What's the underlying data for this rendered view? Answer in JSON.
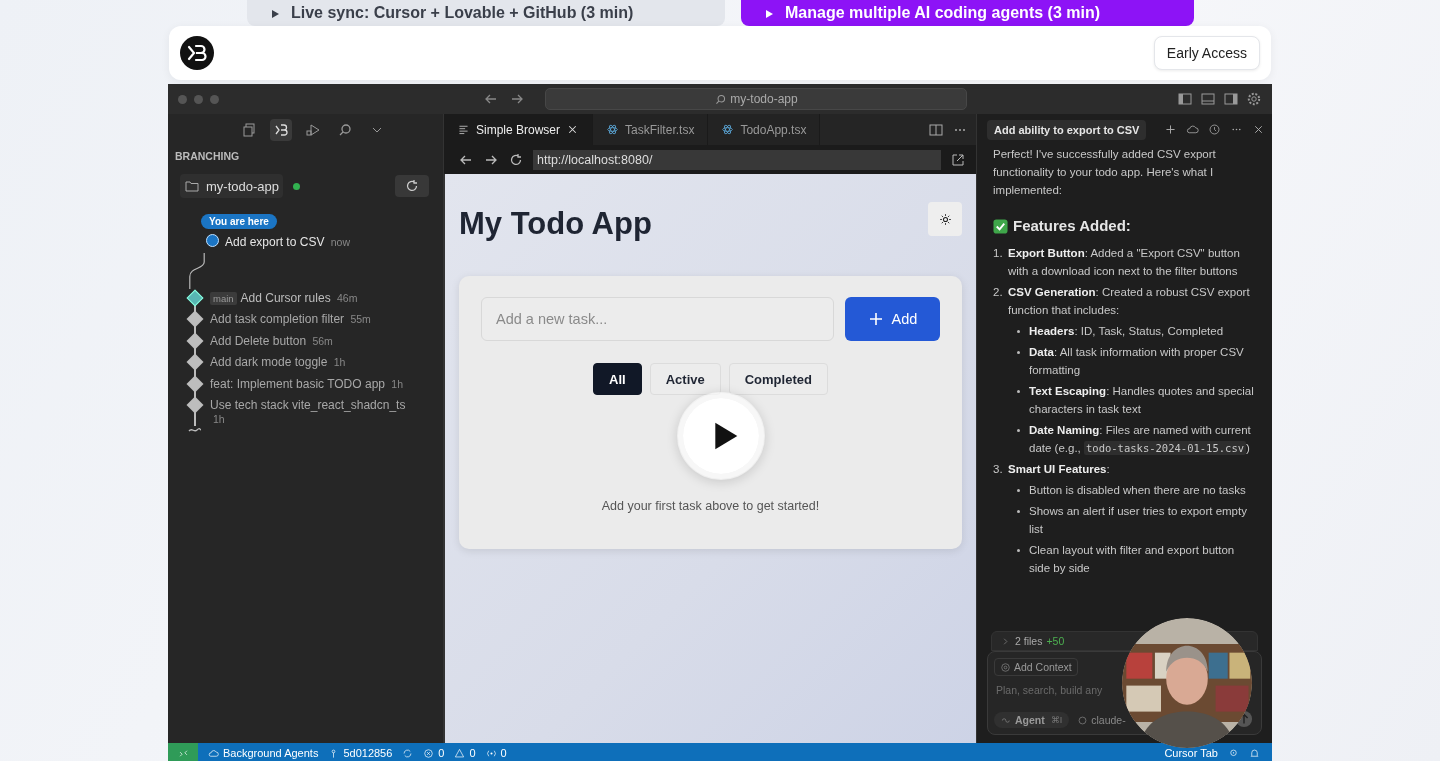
{
  "promo_buttons": [
    {
      "label": "Live sync: Cursor + Lovable + GitHub (3 min)",
      "kind": "secondary"
    },
    {
      "label": "Manage multiple AI coding agents (3 min)",
      "kind": "primary"
    }
  ],
  "header": {
    "cta": "Early Access"
  },
  "ide": {
    "search": "my-todo-app",
    "sidebar": {
      "title": "BRANCHING",
      "repo": "my-todo-app",
      "repo_online": true,
      "here_badge": "You are here",
      "commits": [
        {
          "kind": "current",
          "message": "Add export to CSV",
          "time": "now"
        },
        {
          "kind": "head",
          "branch": "main",
          "message": "Add Cursor rules",
          "time": "46m"
        },
        {
          "kind": "commit",
          "message": "Add task completion filter",
          "time": "55m"
        },
        {
          "kind": "commit",
          "message": "Add Delete button",
          "time": "56m"
        },
        {
          "kind": "commit",
          "message": "Add dark mode toggle",
          "time": "1h"
        },
        {
          "kind": "commit",
          "message": "feat: Implement basic TODO app",
          "time": "1h"
        },
        {
          "kind": "commit",
          "message": "Use tech stack vite_react_shadcn_ts",
          "time": "1h"
        }
      ]
    },
    "tabs": [
      {
        "label": "Simple Browser",
        "kind": "browser",
        "selected": true
      },
      {
        "label": "TaskFilter.tsx",
        "kind": "react",
        "selected": false
      },
      {
        "label": "TodoApp.tsx",
        "kind": "react",
        "selected": false
      }
    ],
    "url": "http://localhost:8080/",
    "app": {
      "title": "My Todo App",
      "placeholder": "Add a new task...",
      "add": "Add",
      "filters": [
        {
          "label": "All",
          "selected": true
        },
        {
          "label": "Active",
          "selected": false
        },
        {
          "label": "Completed",
          "selected": false
        }
      ],
      "empty": "Add your first task above to get started!"
    },
    "chat": {
      "title": "Add ability to export to CSV",
      "intro": "Perfect! I've successfully added CSV export functionality to your todo app. Here's what I implemented:",
      "heading": "Features Added:",
      "items": [
        {
          "number": "1.",
          "text": "**Export Button**: Added a \"Export CSV\" button with a download icon next to the filter buttons"
        },
        {
          "number": "2.",
          "text": "**CSV Generation**: Created a robust CSV export function that includes:",
          "bullets": [
            {
              "text": "**Headers**: ID, Task, Status, Completed"
            },
            {
              "text": "**Data**: All task information with proper CSV formatting"
            },
            {
              "text": "**Text Escaping**: Handles quotes and special characters in task text"
            },
            {
              "text": "**Date Naming**: Files are named with current date (e.g., ",
              "code": "todo-tasks-2024-01-15.csv",
              "after": ")"
            }
          ]
        },
        {
          "number": "3.",
          "text": "**Smart UI Features**:",
          "bullets": [
            {
              "text": "Button is disabled when there are no tasks"
            },
            {
              "text": "Shows an alert if user tries to export empty list"
            },
            {
              "text": "Clean layout with filter and export button side by side"
            }
          ]
        }
      ],
      "files": "2 files",
      "added": "+50",
      "context": "Add Context",
      "placeholder": "Plan, search, build any",
      "mode": "Agent",
      "shortcut": "⌘I",
      "model": "claude-"
    },
    "status_bar": {
      "agents": "Background Agents",
      "commit": "5d012856",
      "errors": "0",
      "warnings": "0",
      "ports": "0",
      "mode": "Cursor Tab"
    }
  }
}
